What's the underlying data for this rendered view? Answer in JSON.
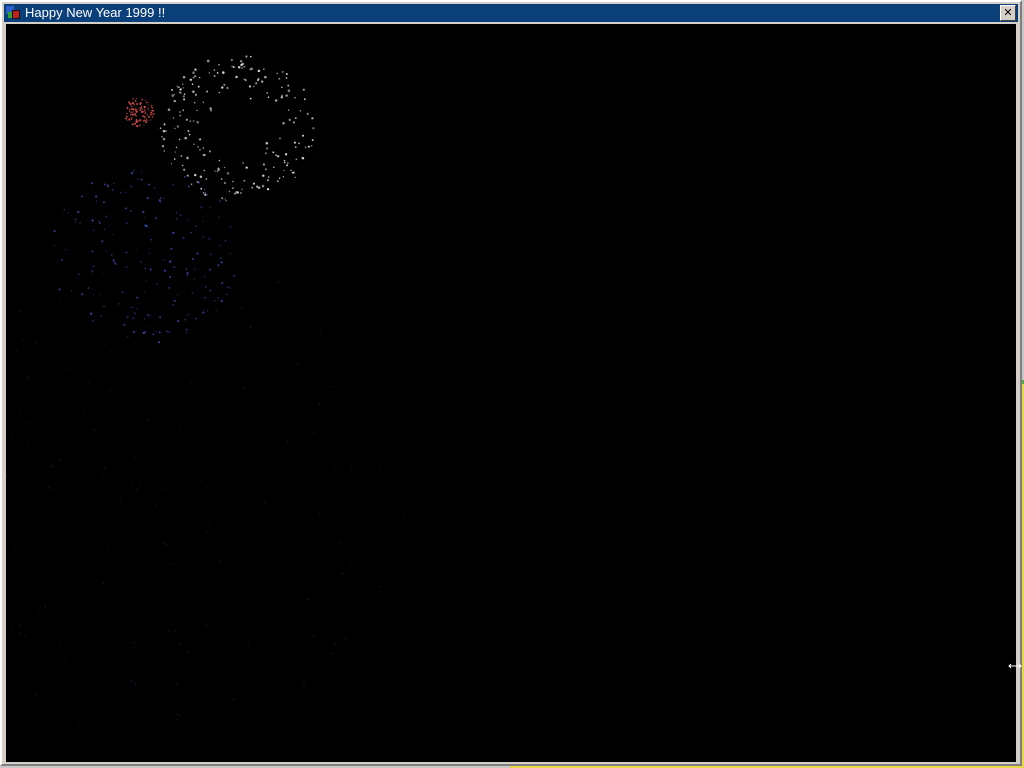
{
  "window": {
    "title": "Happy New Year 1999 !!",
    "close_glyph": "✕",
    "icon": "fireworks-app-icon"
  },
  "fireworks": {
    "background_color": "#000000",
    "bursts": [
      {
        "name": "white-burst",
        "color": "#e8e8e8"
      },
      {
        "name": "red-burst",
        "color": "#e05050"
      },
      {
        "name": "blue-burst",
        "color": "#4a5ad8"
      },
      {
        "name": "fading-trail",
        "color": "#3a3a70"
      }
    ]
  },
  "colors": {
    "titlebar": "#0b3f7a",
    "desktop_accent_yellow": "#e6d84a",
    "desktop_accent_green": "#5aa845"
  },
  "cursor": "resize-cursor-icon"
}
